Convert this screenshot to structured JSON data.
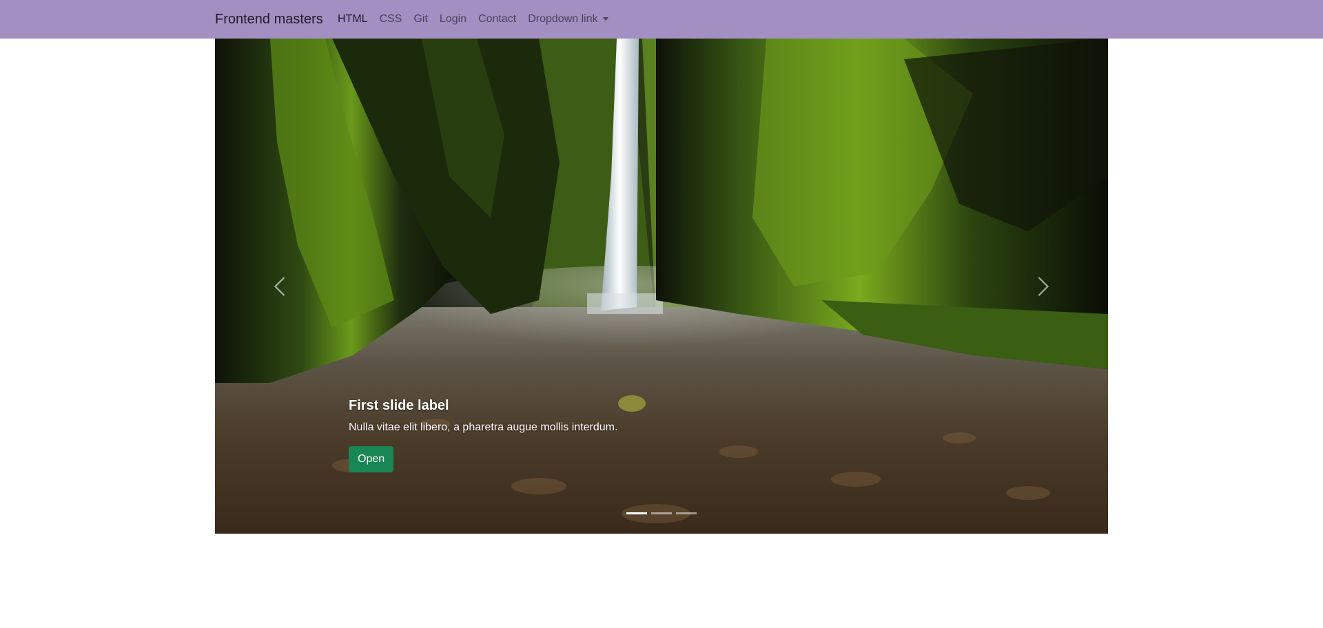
{
  "navbar": {
    "brand": "Frontend masters",
    "links": [
      {
        "label": "HTML",
        "active": true
      },
      {
        "label": "CSS",
        "active": false
      },
      {
        "label": "Git",
        "active": false
      },
      {
        "label": "Login",
        "active": false
      },
      {
        "label": "Contact",
        "active": false
      }
    ],
    "dropdown_label": "Dropdown link",
    "background_color": "#a38fc2"
  },
  "carousel": {
    "image_subject": "waterfall in a moss-covered canyon",
    "caption": {
      "title": "First slide label",
      "text": "Nulla vitae elit libero, a pharetra augue mollis interdum.",
      "button_label": "Open",
      "button_color": "#198754"
    },
    "indicators": {
      "count": 3,
      "active_index": 0
    },
    "controls": {
      "prev_icon": "chevron-left-icon",
      "next_icon": "chevron-right-icon"
    }
  }
}
